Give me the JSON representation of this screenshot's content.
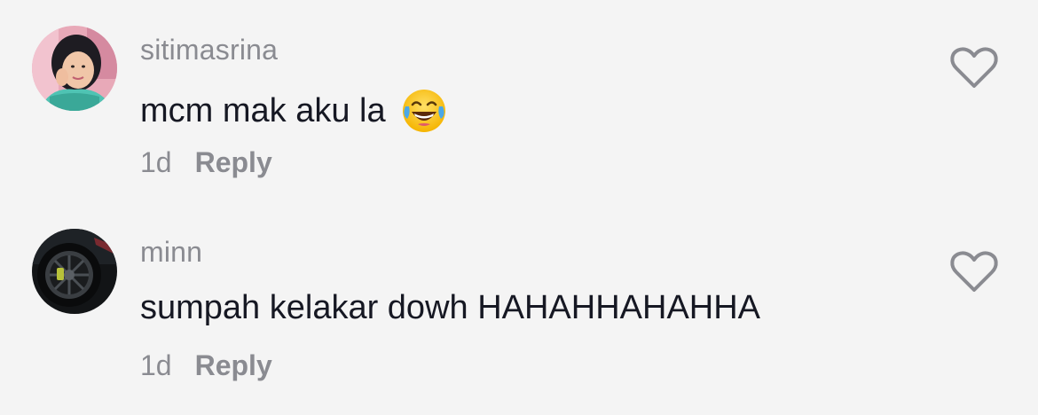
{
  "comments": [
    {
      "username": "sitimasrina",
      "text": "mcm mak aku la",
      "emoji": "face-with-tears-of-joy",
      "time": "1d",
      "reply_label": "Reply"
    },
    {
      "username": "minn",
      "text": "sumpah kelakar dowh HAHAHHAHAHHA",
      "time": "1d",
      "reply_label": "Reply"
    }
  ],
  "colors": {
    "background": "#f4f4f4",
    "username": "#8a8b91",
    "text": "#161823",
    "icon": "#8a8b91"
  }
}
